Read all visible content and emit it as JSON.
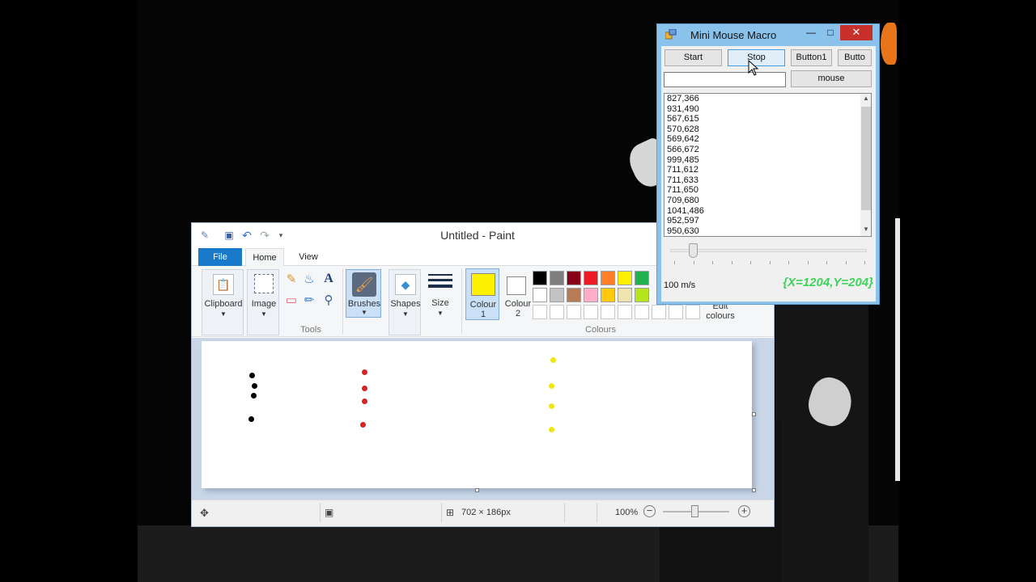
{
  "paint": {
    "title": "Untitled - Paint",
    "tabs": [
      {
        "label": "File"
      },
      {
        "label": "Home"
      },
      {
        "label": "View"
      }
    ],
    "ribbon": {
      "clipboard": "Clipboard",
      "image": "Image",
      "tools": "Tools",
      "brushes": "Brushes",
      "shapes": "Shapes",
      "size": "Size",
      "colour1_line1": "Colour",
      "colour1_line2": "1",
      "colour2_line1": "Colour",
      "colour2_line2": "2",
      "colours": "Colours",
      "edit_colours_line1": "Edit",
      "edit_colours_line2": "colours",
      "text_tool": "A"
    },
    "palette_row1": [
      "#000000",
      "#7f7f7f",
      "#880015",
      "#ed1c24",
      "#ff7f27",
      "#fff200",
      "#22b14c"
    ],
    "palette_row2": [
      "#ffffff",
      "#c3c3c3",
      "#b97a57",
      "#ffaec9",
      "#ffc90e",
      "#efe4b0",
      "#b5e61d"
    ],
    "colour1_value": "#fff200",
    "colour2_value": "#ffffff",
    "dots": {
      "black": "#000000",
      "red": "#d42424",
      "yellow": "#ece817"
    },
    "status": {
      "dimensions": "702 × 186px",
      "zoom": "100%",
      "zoom_out": "−",
      "zoom_in": "+"
    }
  },
  "macro": {
    "title": "Mini Mouse Macro",
    "buttons": {
      "start": "Start",
      "stop": "Stop",
      "button1": "Button1",
      "button2": "Butto",
      "mouse": "mouse"
    },
    "input_value": "",
    "coordinates": [
      "827,366",
      "931,490",
      "567,615",
      "570,628",
      "569,642",
      "566,672",
      "999,485",
      "711,612",
      "711,633",
      "711,650",
      "709,680",
      "1041,486",
      "952,597",
      "950,630"
    ],
    "speed": "100 m/s",
    "mouse_position": "{X=1204,Y=204}"
  }
}
